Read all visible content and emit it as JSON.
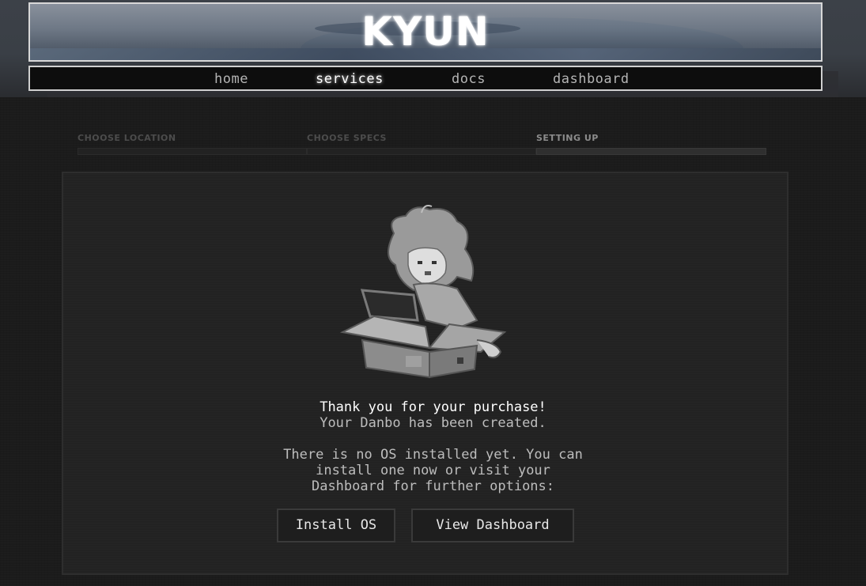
{
  "header": {
    "logo_text": "KYUN"
  },
  "nav": {
    "items": [
      {
        "label": "home",
        "active": false
      },
      {
        "label": "services",
        "active": true
      },
      {
        "label": "docs",
        "active": false
      },
      {
        "label": "dashboard",
        "active": false
      }
    ]
  },
  "steps": {
    "items": [
      {
        "label": "CHOOSE LOCATION",
        "state": "done"
      },
      {
        "label": "CHOOSE SPECS",
        "state": "done"
      },
      {
        "label": "SETTING UP",
        "state": "current"
      }
    ]
  },
  "main": {
    "illustration_icon": "girl-in-cardboard-box-illustration",
    "thanks": "Thank you for your purchase!",
    "created": "Your Danbo has been created.",
    "no_os_line1": "There is no OS installed yet. You can",
    "no_os_line2": "install one now or visit your",
    "no_os_line3": "Dashboard for further options:",
    "install_button": "Install OS",
    "dashboard_button": "View Dashboard"
  },
  "colors": {
    "background": "#1b1b1b",
    "card": "#222222",
    "nav_bg": "#0d0d0d",
    "border_light": "#d8d8d8",
    "text": "#d4d4d4"
  }
}
